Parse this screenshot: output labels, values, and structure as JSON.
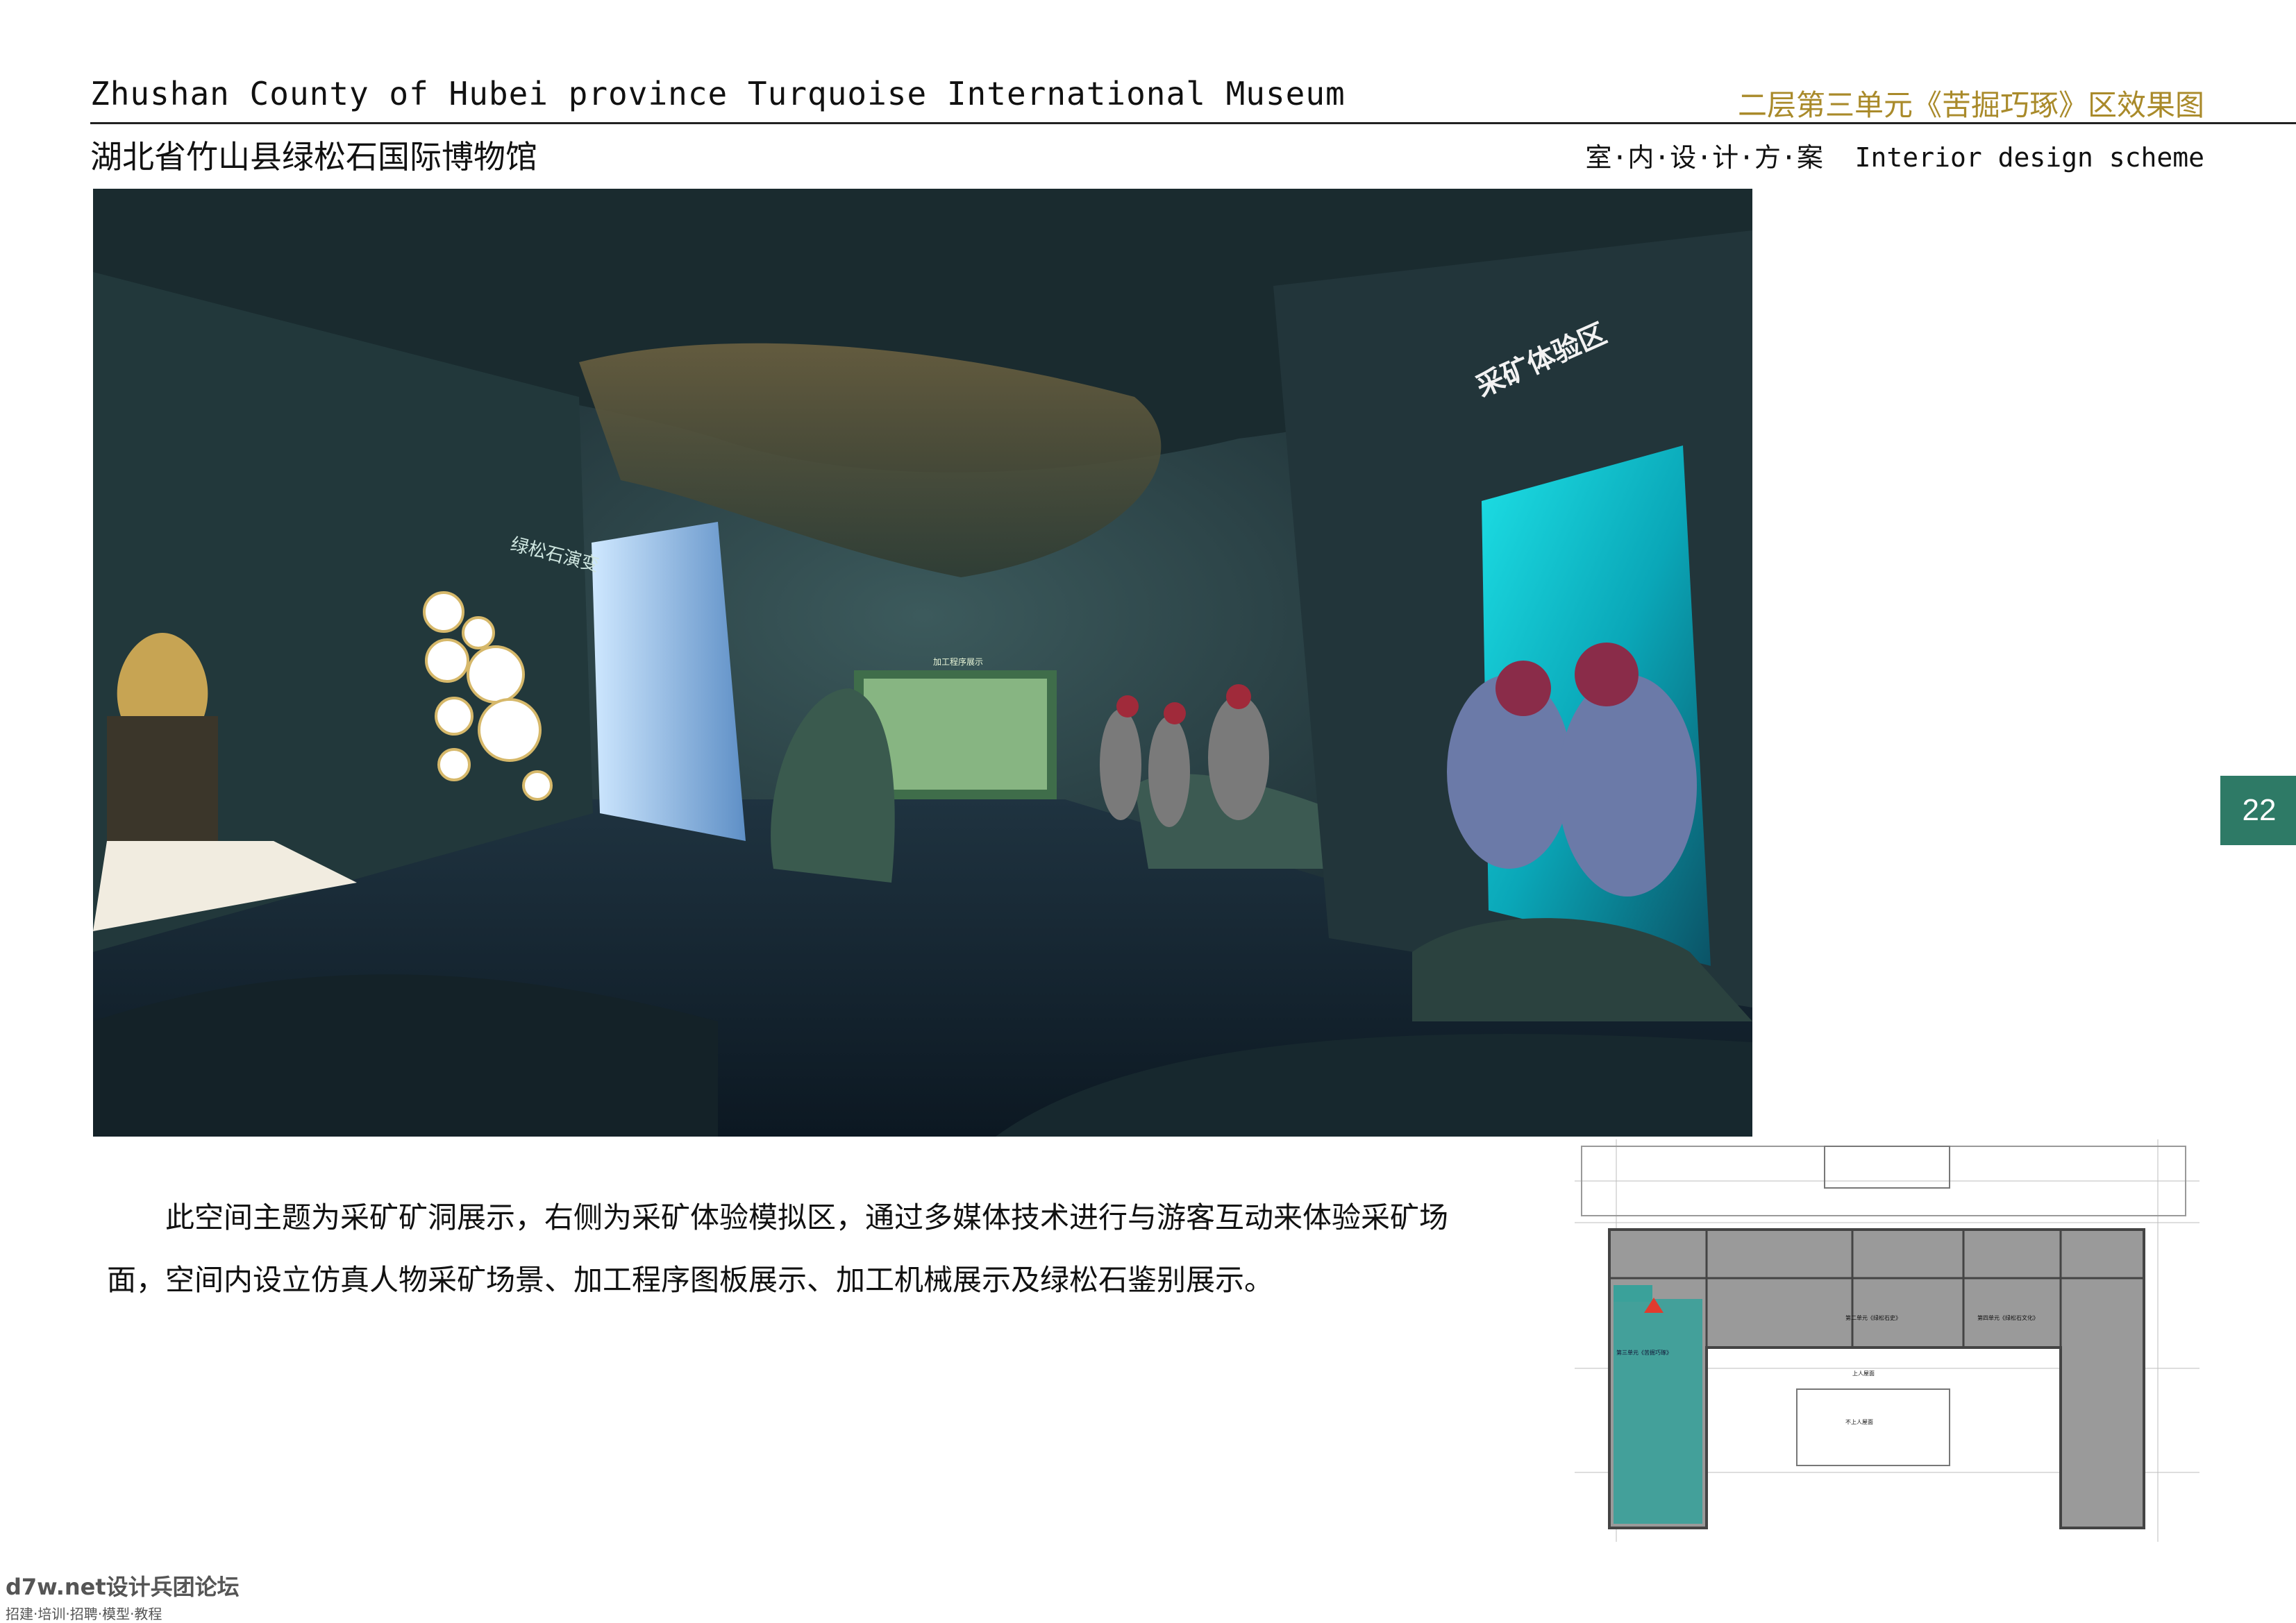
{
  "header": {
    "title_en": "Zhushan County of Hubei province Turquoise International Museum",
    "title_cn": "湖北省竹山县绿松石国际博物馆",
    "section_title": "二层第三单元《苦掘巧琢》区效果图",
    "scheme_label": "室·内·设·计·方·案  Interior design scheme"
  },
  "render": {
    "sign_left": "绿松石演变",
    "sign_right": "采矿体验区",
    "screen_label": "加工程序展示"
  },
  "page_number": "22",
  "description": "此空间主题为采矿矿洞展示，右侧为采矿体验模拟区，通过多媒体技术进行与游客互动来体验采矿场面，空间内设立仿真人物采矿场景、加工程序图板展示、加工机械展示及绿松石鉴别展示。",
  "floor_plan": {
    "labels": {
      "zone_left": "第三单元《苦掘巧琢》",
      "zone_mid": "第二单元《绿松石史》",
      "zone_right": "第四单元《绿松石文化》",
      "stairs": "上人屋面",
      "roof": "不上人屋面"
    },
    "colors": {
      "highlight": "#3aa19a",
      "marker": "#e23b2e",
      "wall": "#444444",
      "floor": "#9a9a9a"
    }
  },
  "watermark": {
    "line1": "d7w.net设计兵团论坛",
    "line2": "招建·培训·招聘·模型·教程"
  },
  "colors": {
    "accent_gold": "#a98a2a",
    "tab_green": "#2e7a66"
  }
}
